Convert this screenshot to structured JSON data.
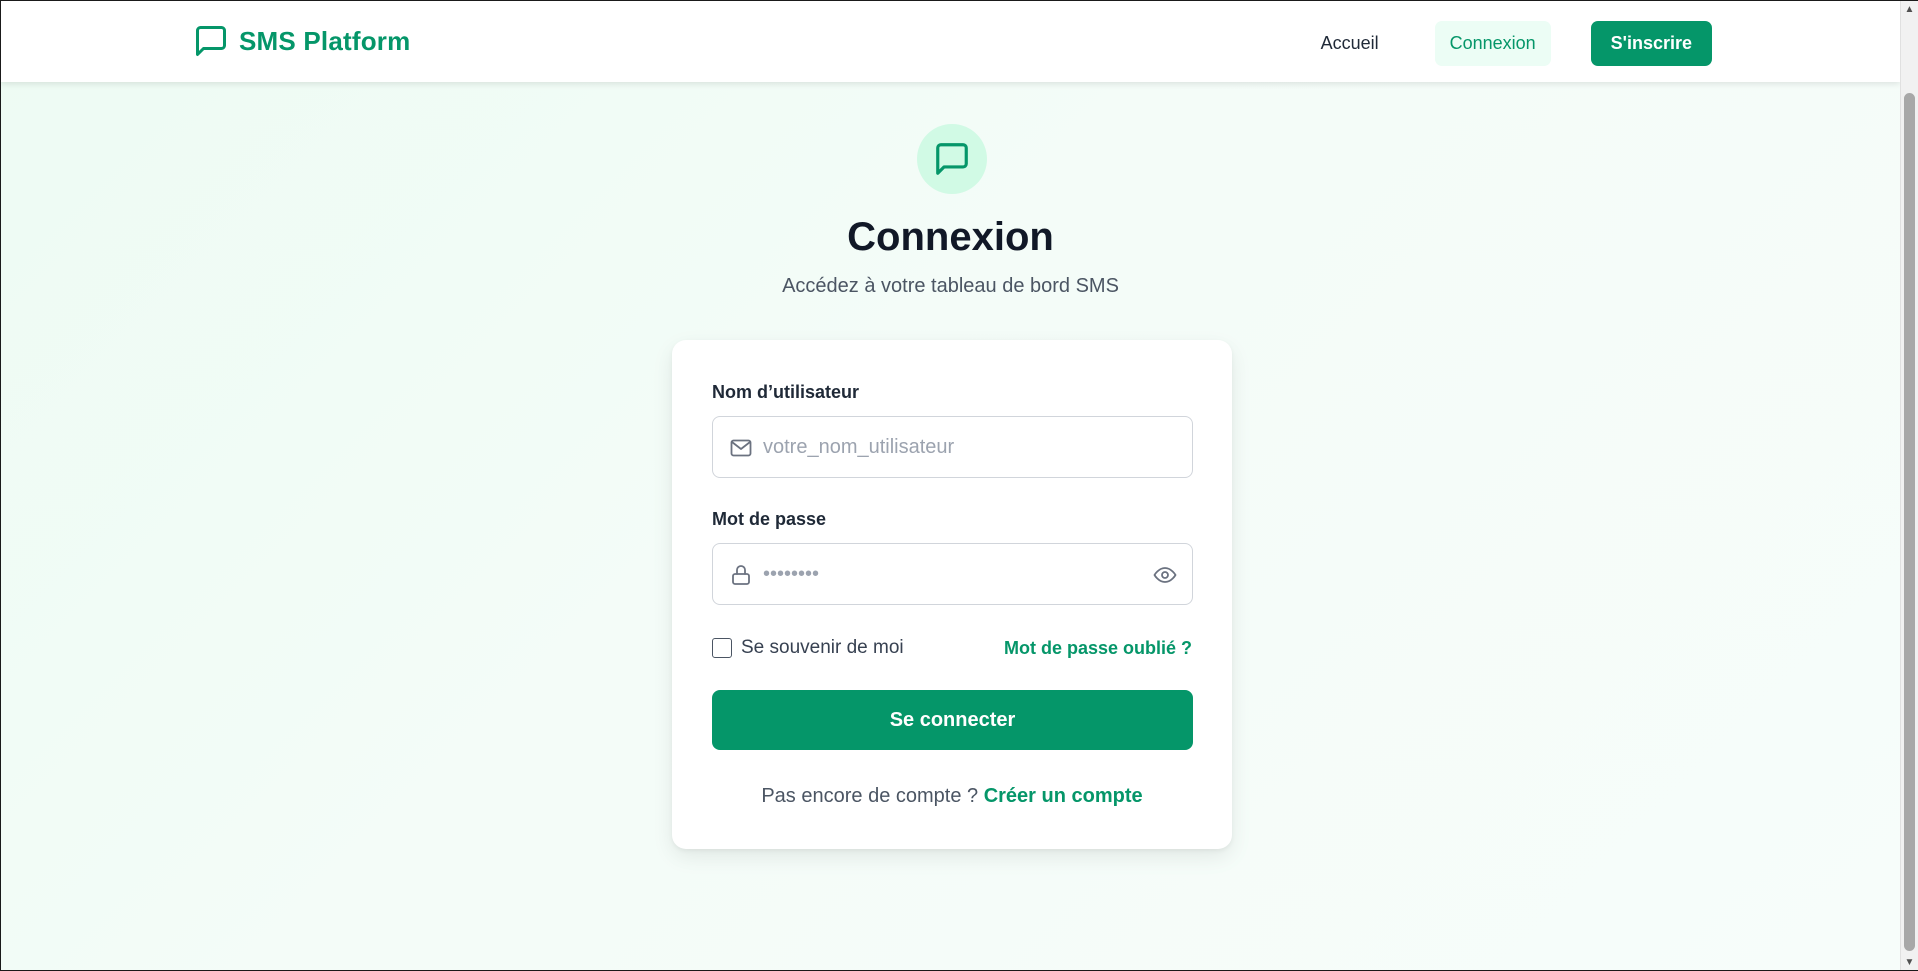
{
  "brand": {
    "name": "SMS Platform",
    "icon": "message-square-icon",
    "color": "#059669"
  },
  "nav": {
    "home": "Accueil",
    "login": "Connexion",
    "signup": "S'inscrire"
  },
  "hero": {
    "icon": "message-square-icon",
    "title": "Connexion",
    "subtitle": "Accédez à votre tableau de bord SMS"
  },
  "form": {
    "username": {
      "label": "Nom d’utilisateur",
      "placeholder": "votre_nom_utilisateur",
      "value": "",
      "icon": "mail-icon"
    },
    "password": {
      "label": "Mot de passe",
      "placeholder": "••••••••",
      "value": "",
      "icon": "lock-icon",
      "toggle_icon": "eye-icon"
    },
    "remember": {
      "label": "Se souvenir de moi",
      "checked": false
    },
    "forgot": "Mot de passe oublié ?",
    "submit": "Se connecter",
    "signup_prompt": "Pas encore de compte ?",
    "signup_link": "Créer un compte"
  },
  "colors": {
    "accent": "#059669",
    "accent_light": "#ecfdf5",
    "badge_bg": "#d1fae5",
    "text_dark": "#111827"
  }
}
